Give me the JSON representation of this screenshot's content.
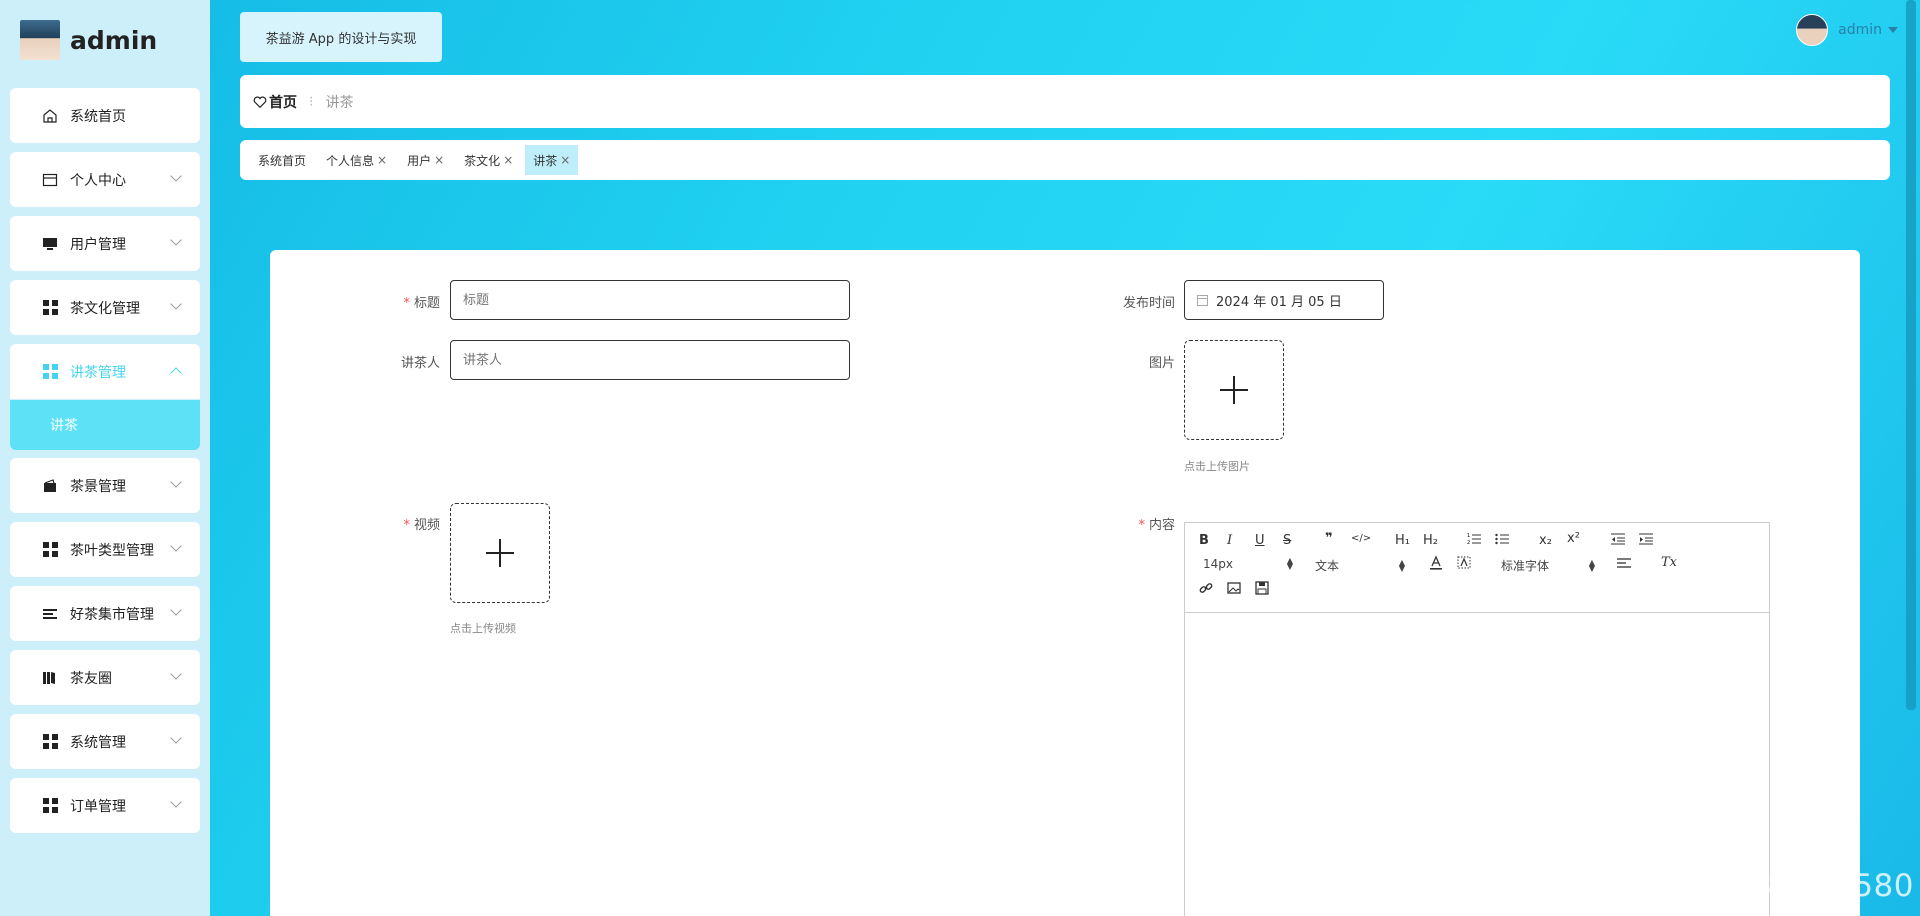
{
  "sidebar": {
    "title": "admin",
    "items": [
      {
        "label": "系统首页",
        "icon": "home-icon"
      },
      {
        "label": "个人中心",
        "icon": "card-icon"
      },
      {
        "label": "用户管理",
        "icon": "monitor-icon"
      },
      {
        "label": "茶文化管理",
        "icon": "grid-icon"
      },
      {
        "label": "讲茶管理",
        "icon": "grid-icon"
      },
      {
        "label": "茶景管理",
        "icon": "wallet-icon"
      },
      {
        "label": "茶叶类型管理",
        "icon": "grid-icon"
      },
      {
        "label": "好茶集市管理",
        "icon": "list-icon"
      },
      {
        "label": "茶友圈",
        "icon": "book-icon"
      },
      {
        "label": "系统管理",
        "icon": "grid-icon"
      },
      {
        "label": "订单管理",
        "icon": "grid-icon"
      }
    ],
    "submenu": {
      "label": "讲茶"
    }
  },
  "header": {
    "system_title": "茶益游 App 的设计与实现",
    "user": "admin"
  },
  "breadcrumb": {
    "home": "首页",
    "separator": "⁝",
    "current": "讲茶"
  },
  "tags": [
    {
      "label": "系统首页",
      "closable": false
    },
    {
      "label": "个人信息",
      "closable": true
    },
    {
      "label": "用户",
      "closable": true
    },
    {
      "label": "茶文化",
      "closable": true
    },
    {
      "label": "讲茶",
      "closable": true,
      "active": true
    }
  ],
  "tag_close": "×",
  "form": {
    "title_label": "标题",
    "title_placeholder": "标题",
    "speaker_label": "讲茶人",
    "speaker_placeholder": "讲茶人",
    "video_label": "视频",
    "video_tip": "点击上传视频",
    "publish_label": "发布时间",
    "publish_value": "2024 年 01 月 05 日",
    "image_label": "图片",
    "image_tip": "点击上传图片",
    "content_label": "内容",
    "required_mark": "*"
  },
  "editor": {
    "font_size": "14px",
    "paragraph": "文本",
    "font_family": "标准字体",
    "buttons": [
      "B",
      "I",
      "U",
      "S",
      "❞",
      "</>",
      "H₁",
      "H₂",
      "x₂",
      "x²",
      "Tx"
    ]
  },
  "watermark": "CSDN @QQ1980691580",
  "colors": {
    "accent": "#45d4ef",
    "sidebar_bg": "#cdeffa",
    "active_sub": "#5ce1f7"
  }
}
